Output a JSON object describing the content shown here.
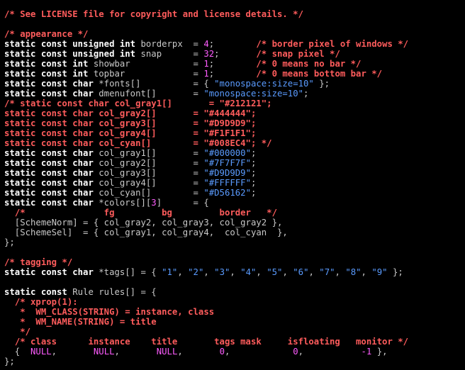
{
  "editor": {
    "colors": {
      "background": "#000000",
      "keyword": "#ffffff",
      "identifier": "#c8c8c8",
      "number": "#ff5cff",
      "string": "#5a9bff",
      "comment": "#ff5c5c"
    },
    "lines": [
      [
        {
          "t": "/* See LICENSE file for copyright and license details. */",
          "c": "cm"
        }
      ],
      [],
      [
        {
          "t": "/* appearance */",
          "c": "cm"
        }
      ],
      [
        {
          "t": "static const unsigned int",
          "c": "kw"
        },
        {
          "t": " borderpx  = ",
          "c": "id"
        },
        {
          "t": "4",
          "c": "num"
        },
        {
          "t": ";        ",
          "c": "op"
        },
        {
          "t": "/* border pixel of windows */",
          "c": "cm"
        }
      ],
      [
        {
          "t": "static const unsigned int",
          "c": "kw"
        },
        {
          "t": " snap      = ",
          "c": "id"
        },
        {
          "t": "32",
          "c": "num"
        },
        {
          "t": ";       ",
          "c": "op"
        },
        {
          "t": "/* snap pixel */",
          "c": "cm"
        }
      ],
      [
        {
          "t": "static const int",
          "c": "kw"
        },
        {
          "t": " showbar            = ",
          "c": "id"
        },
        {
          "t": "1",
          "c": "num"
        },
        {
          "t": ";        ",
          "c": "op"
        },
        {
          "t": "/* 0 means no bar */",
          "c": "cm"
        }
      ],
      [
        {
          "t": "static const int",
          "c": "kw"
        },
        {
          "t": " topbar             = ",
          "c": "id"
        },
        {
          "t": "1",
          "c": "num"
        },
        {
          "t": ";        ",
          "c": "op"
        },
        {
          "t": "/* 0 means bottom bar */",
          "c": "cm"
        }
      ],
      [
        {
          "t": "static const char",
          "c": "kw"
        },
        {
          "t": " *fonts[]          = { ",
          "c": "id"
        },
        {
          "t": "\"monospace:size=10\"",
          "c": "str"
        },
        {
          "t": " };",
          "c": "op"
        }
      ],
      [
        {
          "t": "static const char",
          "c": "kw"
        },
        {
          "t": " dmenufont[]       = ",
          "c": "id"
        },
        {
          "t": "\"monospace:size=10\"",
          "c": "str"
        },
        {
          "t": ";",
          "c": "op"
        }
      ],
      [
        {
          "t": "/* static const char col_gray1[]       = \"#212121\";",
          "c": "cm"
        }
      ],
      [
        {
          "t": "static const char col_gray2[]       = \"#444444\";",
          "c": "cm"
        }
      ],
      [
        {
          "t": "static const char col_gray3[]       = \"#D9D9D9\";",
          "c": "cm"
        }
      ],
      [
        {
          "t": "static const char col_gray4[]       = \"#F1F1F1\";",
          "c": "cm"
        }
      ],
      [
        {
          "t": "static const char col_cyan[]        = \"#008EC4\"; */",
          "c": "cm"
        }
      ],
      [
        {
          "t": "static const char",
          "c": "kw"
        },
        {
          "t": " col_gray1[]       = ",
          "c": "id"
        },
        {
          "t": "\"#000000\"",
          "c": "str"
        },
        {
          "t": ";",
          "c": "op"
        }
      ],
      [
        {
          "t": "static const char",
          "c": "kw"
        },
        {
          "t": " col_gray2[]       = ",
          "c": "id"
        },
        {
          "t": "\"#7F7F7F\"",
          "c": "str"
        },
        {
          "t": ";",
          "c": "op"
        }
      ],
      [
        {
          "t": "static const char",
          "c": "kw"
        },
        {
          "t": " col_gray3[]       = ",
          "c": "id"
        },
        {
          "t": "\"#D9D9D9\"",
          "c": "str"
        },
        {
          "t": ";",
          "c": "op"
        }
      ],
      [
        {
          "t": "static const char",
          "c": "kw"
        },
        {
          "t": " col_gray4[]       = ",
          "c": "id"
        },
        {
          "t": "\"#FFFFFF\"",
          "c": "str"
        },
        {
          "t": ";",
          "c": "op"
        }
      ],
      [
        {
          "t": "static const char",
          "c": "kw"
        },
        {
          "t": " col_cyan[]        = ",
          "c": "id"
        },
        {
          "t": "\"#D56162\"",
          "c": "str"
        },
        {
          "t": ";",
          "c": "op"
        }
      ],
      [
        {
          "t": "static const char",
          "c": "kw"
        },
        {
          "t": " *colors[][",
          "c": "id"
        },
        {
          "t": "3",
          "c": "num"
        },
        {
          "t": "]      = {",
          "c": "op"
        }
      ],
      [
        {
          "t": "  ",
          "c": "op"
        },
        {
          "t": "/*               fg         bg         border   */",
          "c": "cm"
        }
      ],
      [
        {
          "t": "  [SchemeNorm] = { col_gray2, col_gray3, col_gray2 },",
          "c": "id"
        }
      ],
      [
        {
          "t": "  [SchemeSel]  = { col_gray1, col_gray4,  col_cyan  },",
          "c": "id"
        }
      ],
      [
        {
          "t": "};",
          "c": "op"
        }
      ],
      [],
      [
        {
          "t": "/* tagging */",
          "c": "cm"
        }
      ],
      [
        {
          "t": "static const char",
          "c": "kw"
        },
        {
          "t": " *tags[] = { ",
          "c": "id"
        },
        {
          "t": "\"1\"",
          "c": "str"
        },
        {
          "t": ", ",
          "c": "op"
        },
        {
          "t": "\"2\"",
          "c": "str"
        },
        {
          "t": ", ",
          "c": "op"
        },
        {
          "t": "\"3\"",
          "c": "str"
        },
        {
          "t": ", ",
          "c": "op"
        },
        {
          "t": "\"4\"",
          "c": "str"
        },
        {
          "t": ", ",
          "c": "op"
        },
        {
          "t": "\"5\"",
          "c": "str"
        },
        {
          "t": ", ",
          "c": "op"
        },
        {
          "t": "\"6\"",
          "c": "str"
        },
        {
          "t": ", ",
          "c": "op"
        },
        {
          "t": "\"7\"",
          "c": "str"
        },
        {
          "t": ", ",
          "c": "op"
        },
        {
          "t": "\"8\"",
          "c": "str"
        },
        {
          "t": ", ",
          "c": "op"
        },
        {
          "t": "\"9\"",
          "c": "str"
        },
        {
          "t": " };",
          "c": "op"
        }
      ],
      [],
      [
        {
          "t": "static const",
          "c": "kw"
        },
        {
          "t": " Rule rules[] = {",
          "c": "id"
        }
      ],
      [
        {
          "t": "  ",
          "c": "op"
        },
        {
          "t": "/* xprop(1):",
          "c": "cm"
        }
      ],
      [
        {
          "t": "   *  WM_CLASS(STRING) = instance, class",
          "c": "cm"
        }
      ],
      [
        {
          "t": "   *  WM_NAME(STRING) = title",
          "c": "cm"
        }
      ],
      [
        {
          "t": "   */",
          "c": "cm"
        }
      ],
      [
        {
          "t": "  ",
          "c": "op"
        },
        {
          "t": "/* class      instance    title       tags mask     isfloating   monitor */",
          "c": "cm"
        }
      ],
      [
        {
          "t": "  {  ",
          "c": "op"
        },
        {
          "t": "NULL",
          "c": "mac"
        },
        {
          "t": ",       ",
          "c": "op"
        },
        {
          "t": "NULL",
          "c": "mac"
        },
        {
          "t": ",       ",
          "c": "op"
        },
        {
          "t": "NULL",
          "c": "mac"
        },
        {
          "t": ",       ",
          "c": "op"
        },
        {
          "t": "0",
          "c": "num"
        },
        {
          "t": ",            ",
          "c": "op"
        },
        {
          "t": "0",
          "c": "num"
        },
        {
          "t": ",           ",
          "c": "op"
        },
        {
          "t": "-1",
          "c": "num"
        },
        {
          "t": " },",
          "c": "op"
        }
      ],
      [
        {
          "t": "};",
          "c": "op"
        }
      ]
    ]
  }
}
